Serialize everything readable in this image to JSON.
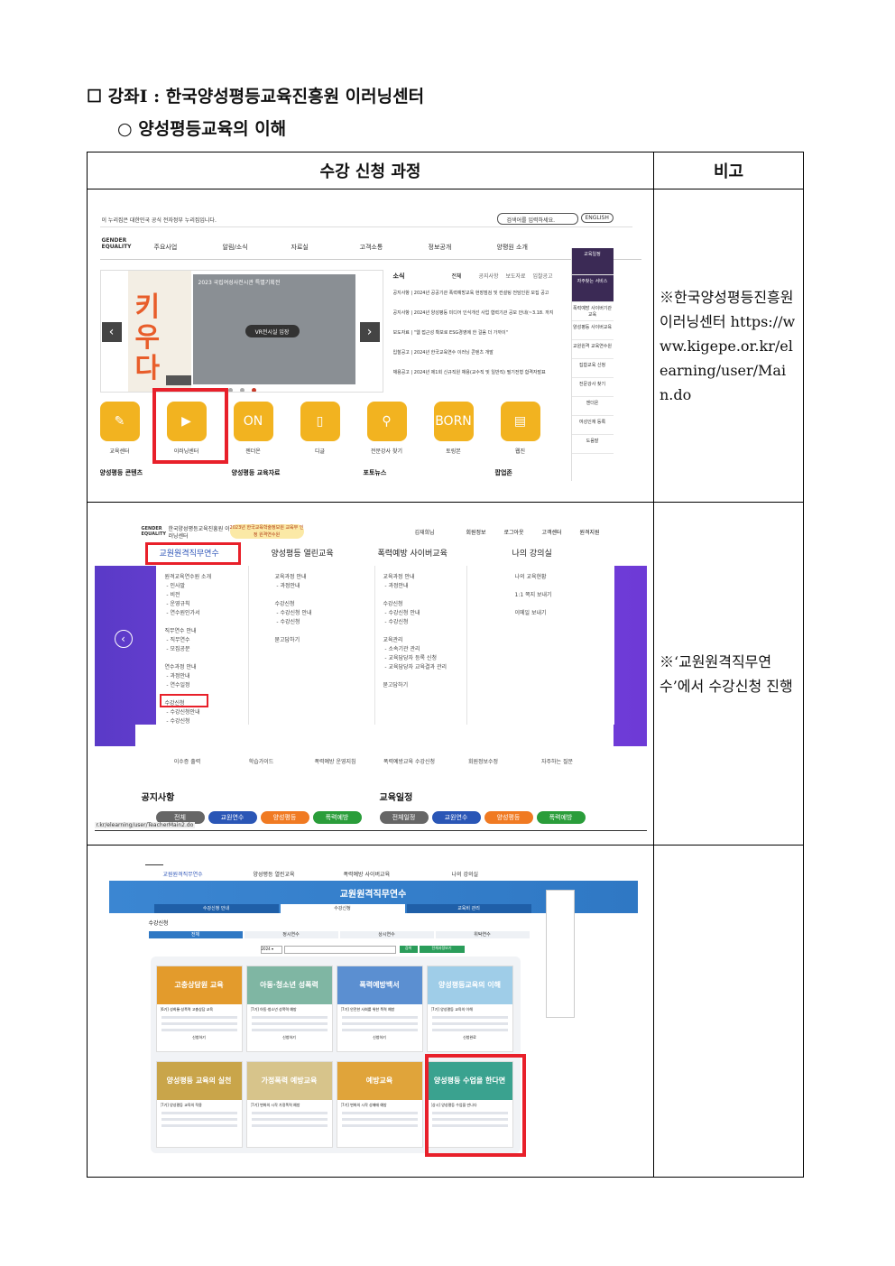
{
  "heading": {
    "checkbox": "☐",
    "lecture": "강좌Ⅰ : 한국양성평등교육진흥원 이러닝센터",
    "bullet": "○",
    "course": "양성평등교육의 이해"
  },
  "table": {
    "col1_header": "수강 신청 과정",
    "col2_header": "비고",
    "row1_note": "※한국양성평등진흥원 이러닝센터 https://www.kigepe.or.kr/elearning/user/Main.do",
    "row2_note": "※‘교원원격직무연수’에서 수강신청 진행",
    "row3_note": ""
  },
  "shot1": {
    "gov_notice": "이 누리집은 대한민국 공식 전자정부 누리집입니다.",
    "search_placeholder": "검색어를 입력하세요.",
    "english": "ENGLISH",
    "logo": "GENDER EQUALITY",
    "nav": [
      "주요사업",
      "알림/소식",
      "자료실",
      "고객소통",
      "정보공개",
      "양평원 소개"
    ],
    "banner_title": "2023 국립여성사전시관 특별기획전",
    "banner_big": "키우다",
    "vr_button": "VR전시실 입장",
    "news_title": "소식",
    "news_tabs": [
      "전체",
      "공지사항",
      "보도자료",
      "입찰공고"
    ],
    "news": [
      "공지사항 | 2024년 공공기관 폭력예방교육 현장점검 및 컨설팅 전담인원 모집 공고",
      "공지사항 | 2024년 양성평등 미디어 인식개선 사업 협력기관 공모 안내(~3.18. 까지",
      "보도자료 | \"웹 접근성 확보로 ESG경영에 한 걸음 더 가까이\"",
      "입찰공고 | 2024년 한국교육연수 이러닝 콘텐츠 개발",
      "채용공고 | 2024년 제1회 신규직원 채용(교수직 및 일반직) 필기전형 합격자발표"
    ],
    "side_menu": [
      "교육일정",
      "자주찾는 서비스",
      "폭력예방 사이버기관교육",
      "양성평등 사이버교육",
      "교원원격 교육연수원",
      "집합교육 신청",
      "전문강사 찾기",
      "젠더온",
      "여성인재 등록",
      "도움말"
    ],
    "icons": [
      "교육센터",
      "이러닝센터",
      "젠더온",
      "디글",
      "전문강사 찾기",
      "토링본",
      "웹진"
    ],
    "icon_glyphs": [
      "✎",
      "▶",
      "ON",
      "▯",
      "⚲",
      "BORN",
      "▤"
    ],
    "bottom": [
      "양성평등 콘텐츠",
      "양성평등 교육자료",
      "포토뉴스",
      "팝업존"
    ]
  },
  "shot2": {
    "org": "한국양성평등교육진흥원 이러닝센터",
    "badge": "2023년 한국교육학술정보원 교육부 인정 원격연수원",
    "user": "김재희님",
    "top_links": [
      "회원정보",
      "로그아웃",
      "고객센터",
      "원격지원"
    ],
    "menu": [
      "교원원격직무연수",
      "양성평등 열린교육",
      "폭력예방 사이버교육",
      "나의 강의실"
    ],
    "col1": "원격교육연수원 소개\n - 인사말\n - 비전\n - 운영규칙\n - 연수원인가서\n\n직무연수 안내\n - 직무연수\n - 모집공문\n\n연수과정 안내\n - 과정안내\n - 연수일정\n\n수강신청\n - 수강신청안내\n - 수강신청\n - 교육비 관리\n\n묻고답하기",
    "col2": "교육과정 안내\n - 과정안내\n\n수강신청\n - 수강신청 안내\n - 수강신청\n\n묻고답하기",
    "col3": "교육과정 안내\n - 과정안내\n\n수강신청\n - 수강신청 안내\n - 수강신청\n\n교육관리\n - 소속기관 관리\n - 교육담당자 등록 신청\n - 교육담당자 교육결과 관리\n\n묻고답하기",
    "col4": "나의 교육현황\n\n1:1 쪽지 보내기\n\n이메일 보내기",
    "quick": [
      "이수증 출력",
      "학습가이드",
      "폭력예방 운영지침",
      "폭력예방교육 수강신청",
      "회원정보수정",
      "자주하는 질문"
    ],
    "notice": "공지사항",
    "schedule": "교육일정",
    "pills_left": [
      "전체",
      "교원연수",
      "양성평등",
      "폭력예방"
    ],
    "pills_right": [
      "전체일정",
      "교원연수",
      "양성평등",
      "폭력예방"
    ],
    "url": "r.kr/elearning/user/TeacherMain2.do"
  },
  "shot3": {
    "nav": [
      "교원원격직무연수",
      "양성평등 열린교육",
      "폭력예방 사이버교육",
      "나의 강의실"
    ],
    "banner": "교원원격직무연수",
    "subtabs": [
      "수강신청 안내",
      "수강신청",
      "교육비 관리"
    ],
    "page_title": "수강신청",
    "filter_tabs": [
      "전체",
      "정시연수",
      "상시연수",
      "위탁연수"
    ],
    "search_btn": "검색",
    "all_btn": "전체과정보기",
    "cards": [
      {
        "title": "고충상담원 교육",
        "name": "[6기] 성희롱·성폭력 고충상담 교육",
        "status": "신청하기",
        "color": "#e39b2c"
      },
      {
        "title": "아동·청소년 성폭력",
        "name": "[7기] 아동·청소년 성폭력 예방",
        "status": "신청하기",
        "color": "#7fb6a3"
      },
      {
        "title": "폭력예방백서",
        "name": "[7기] 안전한 사회를 위한 폭력 예방",
        "status": "신청하기",
        "color": "#5b8fd1"
      },
      {
        "title": "양성평등교육의 이해",
        "name": "[7기] 양성평등 교육의 이해",
        "status": "신청완료",
        "color": "#9fcde8"
      },
      {
        "title": "양성평등 교육의 실천",
        "name": "[7기] 양성평등 교육의 적용",
        "status": "",
        "color": "#c9a54a"
      },
      {
        "title": "가정폭력 예방교육",
        "name": "[7기] 변화의 시작 가정폭력 예방",
        "status": "",
        "color": "#d7c48b"
      },
      {
        "title": "예방교육",
        "name": "[7기] 변화의 시작 성매매 예방",
        "status": "",
        "color": "#e0a43a"
      },
      {
        "title": "양성평등 수업을 한다면",
        "name": "[상시] 양성평등 수업을 만나다",
        "status": "",
        "color": "#3aa28f"
      }
    ]
  },
  "colors": {
    "accent_red": "#e8202a",
    "icon_yellow": "#f2b320",
    "banner_blue": "#2f78c4",
    "purple": "#6d3ad6"
  }
}
